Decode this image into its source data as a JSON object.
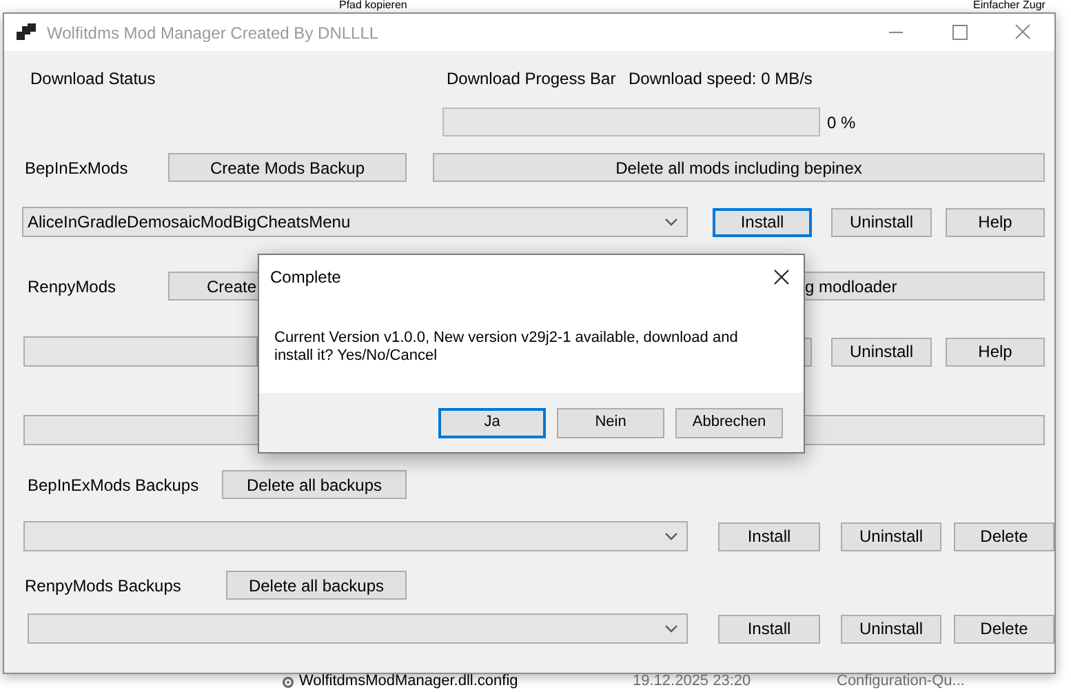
{
  "background_window": {
    "top_items": [
      {
        "label": "Pfad kopieren"
      },
      {
        "label": "Einfacher Zugr"
      }
    ],
    "file_row": {
      "name": "WolfitdmsModManager.dll.config",
      "date": "19.12.2025 23:20",
      "type": "Configuration-Qu..."
    }
  },
  "main_window": {
    "title": "Wolfitdms Mod Manager Created By DNLLLL",
    "download_status_label": "Download Status",
    "progress_label": "Download Progess Bar",
    "speed": "Download speed: 0 MB/s",
    "progress": {
      "level": 0,
      "reading": "0 %"
    },
    "bepinex_mods": {
      "label": "BepInExMods",
      "backup_button": "Create Mods Backup",
      "delete_button": "Delete all mods including bepinex",
      "dropdown": {
        "value": "AliceInGradleDemosaicModBigCheatsMenu"
      },
      "buttons": [
        {
          "kind": "button",
          "label": "Install",
          "focused": true
        },
        {
          "kind": "button",
          "label": "Uninstall",
          "focused": false
        },
        {
          "kind": "button",
          "label": "Help",
          "focused": false
        }
      ]
    },
    "renpy_mods": {
      "label": "RenpyMods",
      "backup_button": "Create",
      "delete_button": "g modloader",
      "buttons": [
        {
          "kind": "covered"
        },
        {
          "kind": "button",
          "label": "Uninstall",
          "focused": false
        },
        {
          "kind": "button",
          "label": "Help",
          "focused": false
        }
      ]
    },
    "backups": [
      {
        "label": "BepInExMods Backups",
        "delete_all": "Delete all backups",
        "buttons": [
          {
            "label": "Install"
          },
          {
            "label": "Uninstall"
          },
          {
            "label": "Delete"
          }
        ]
      },
      {
        "label": "RenpyMods Backups",
        "delete_all": "Delete all backups",
        "buttons": [
          {
            "label": "Install"
          },
          {
            "label": "Uninstall"
          },
          {
            "label": "Delete"
          }
        ]
      }
    ]
  },
  "dialog": {
    "title": "Complete",
    "message": "Current Version v1.0.0, New version v29j2-1 available, download and install it? Yes/No/Cancel",
    "buttons": [
      {
        "label": "Ja",
        "default": true
      },
      {
        "label": "Nein",
        "default": false
      },
      {
        "label": "Abbrechen",
        "default": false
      }
    ]
  }
}
